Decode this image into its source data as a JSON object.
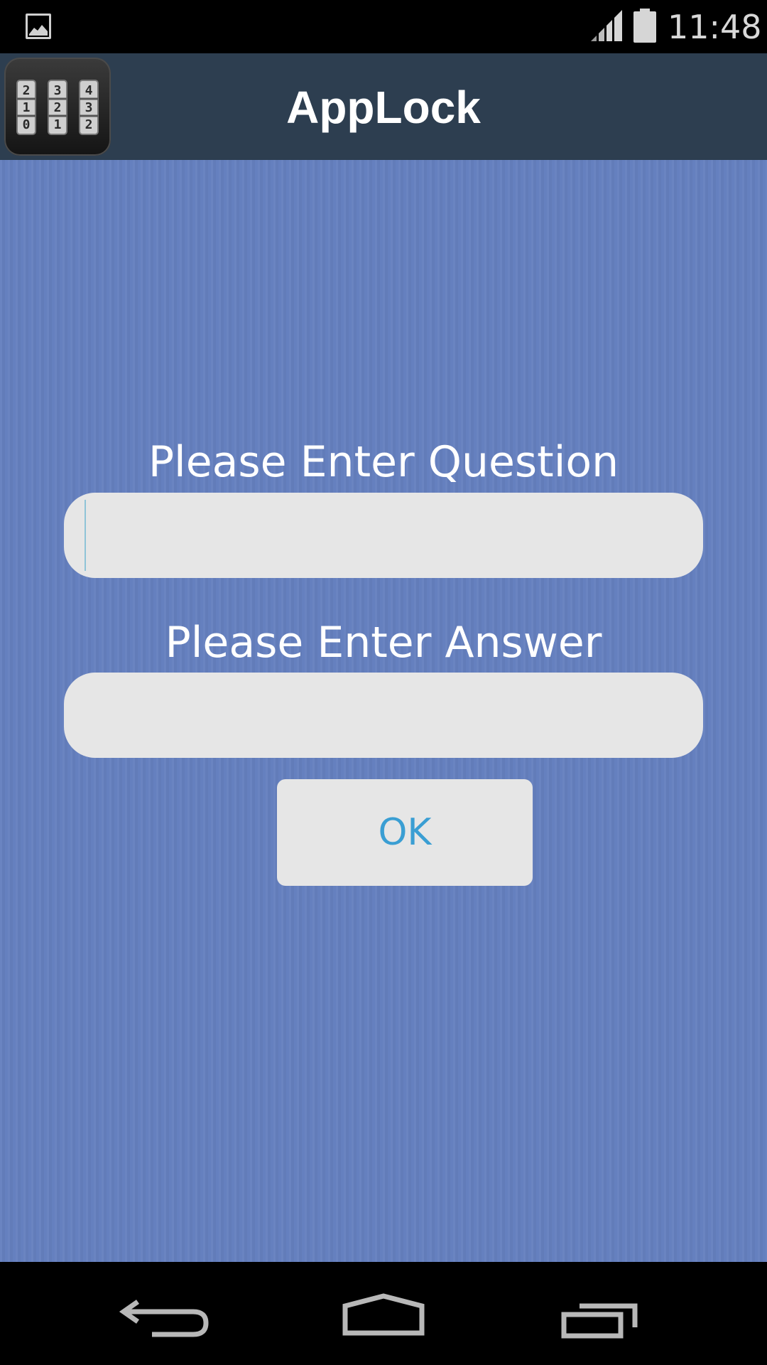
{
  "status_bar": {
    "time": "11:48",
    "notification_icon": "image-icon",
    "signal_icon": "signal-icon",
    "battery_icon": "battery-icon"
  },
  "app_bar": {
    "title": "AppLock",
    "icon": "combination-lock-icon"
  },
  "form": {
    "question_label": "Please Enter Question",
    "question_value": "",
    "answer_label": "Please Enter Answer",
    "answer_value": "",
    "ok_label": "OK"
  },
  "nav_bar": {
    "back_icon": "back-icon",
    "home_icon": "home-icon",
    "recent_icon": "recent-apps-icon"
  },
  "colors": {
    "status_bar_bg": "#000000",
    "app_bar_bg": "#2d3e50",
    "content_bg": "#6580bf",
    "field_bg": "#e6e6e6",
    "ok_text": "#3a9ed3",
    "label_text": "#ffffff"
  }
}
